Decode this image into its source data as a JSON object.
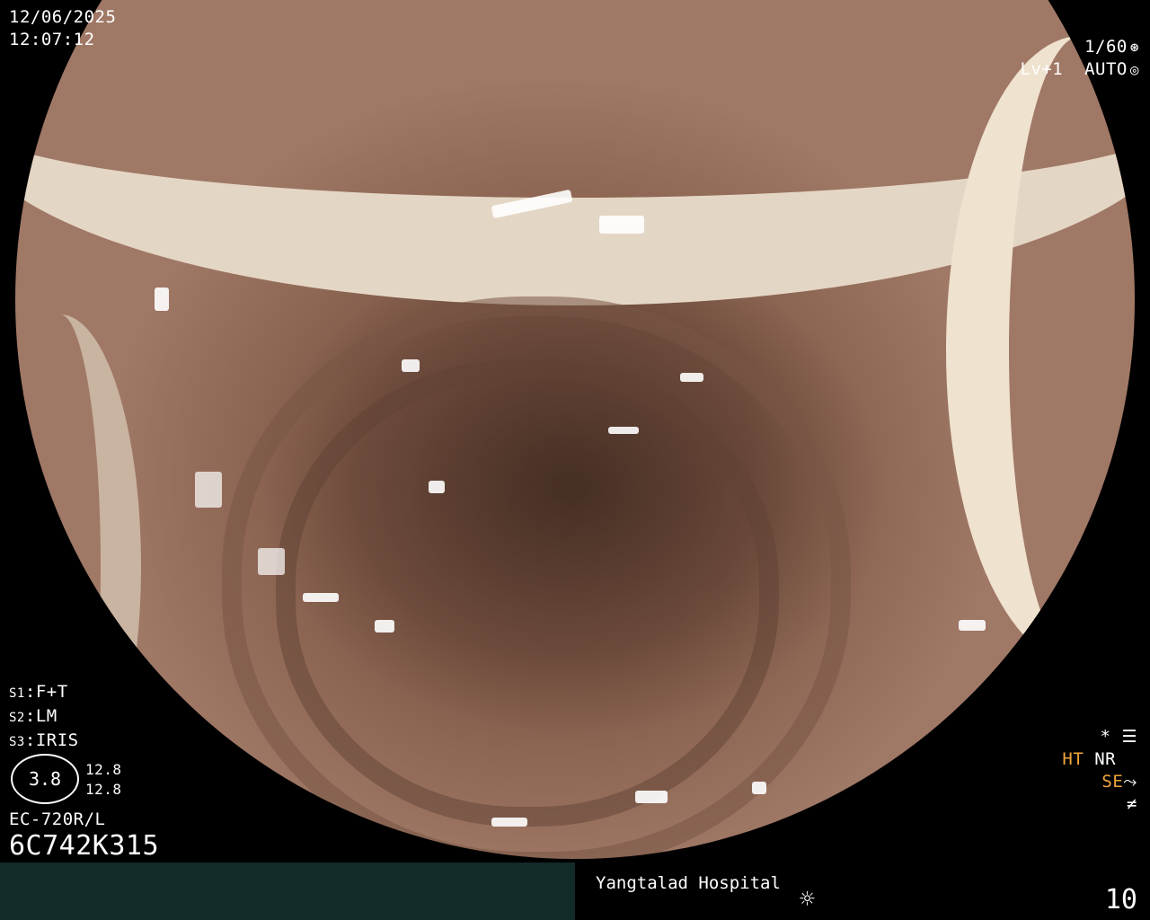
{
  "datetime": {
    "date": "12/06/2025",
    "time": "12:07:12"
  },
  "exposure": {
    "shutter": "1/60",
    "shutter_icon": "aperture-icon",
    "level": "Lv+1",
    "mode": "AUTO",
    "mode_icon": "iris-icon"
  },
  "settings_left": [
    {
      "key": "S1",
      "value": "F+T"
    },
    {
      "key": "S2",
      "value": "LM"
    },
    {
      "key": "S3",
      "value": "IRIS"
    }
  ],
  "scale": {
    "center": "3.8",
    "top": "12.8",
    "bottom": "12.8"
  },
  "scope": {
    "model": "EC-720R/L",
    "serial": "6C742K315"
  },
  "indicators_right": {
    "row1_icon": "asterisk-icon",
    "row1_icon2": "settings-panel-icon",
    "ht": "HT",
    "nr": "NR",
    "se": "SE",
    "se_icon": "enhancement-curve-icon",
    "freeze_icon": "freeze-icon"
  },
  "footer": {
    "hospital": "Yangtalad Hospital",
    "light_icon": "light-icon",
    "counter": "10"
  },
  "colors": {
    "orange": "#f2a53a",
    "bar": "#122a28",
    "text": "#ffffff"
  }
}
